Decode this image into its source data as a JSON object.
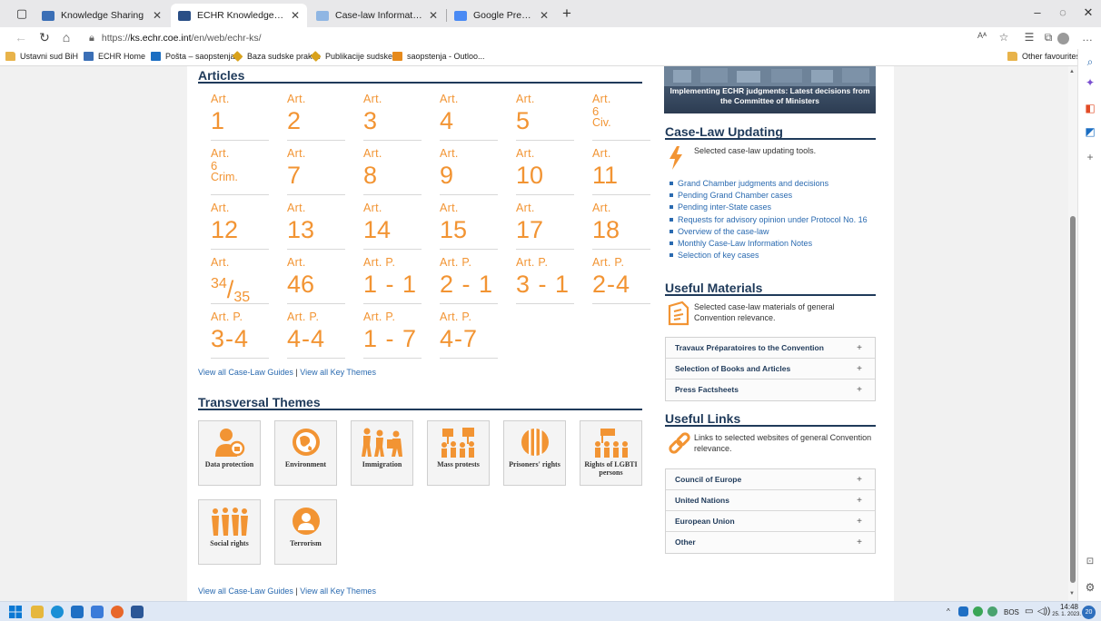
{
  "browser": {
    "tabs": [
      {
        "label": "Knowledge Sharing",
        "active": false
      },
      {
        "label": "ECHR Knowledge Sharing - Gate",
        "active": true
      },
      {
        "label": "Case-law Information Note",
        "active": false
      },
      {
        "label": "Google Prevoditelj",
        "active": false
      }
    ],
    "url_prefix": "https://",
    "url_host": "ks.echr.coe.int",
    "url_path": "/en/web/echr-ks/",
    "reader_label": "Aᴬ",
    "favourites": [
      {
        "label": "Ustavni sud BiH",
        "icon": "folder-icon"
      },
      {
        "label": "ECHR Home",
        "icon": "echr-icon"
      },
      {
        "label": "Pošta – saopstenja...",
        "icon": "outlook-icon"
      },
      {
        "label": "Baza sudske prakse",
        "icon": "diamond-icon"
      },
      {
        "label": "Publikacije sudske...",
        "icon": "diamond-icon"
      },
      {
        "label": "saopstenja - Outloo...",
        "icon": "outlook-icon"
      }
    ],
    "other_favourites": "Other favourites"
  },
  "articles": {
    "heading": "Articles",
    "items": [
      {
        "pre": "Art.",
        "num": "1"
      },
      {
        "pre": "Art.",
        "num": "2"
      },
      {
        "pre": "Art.",
        "num": "3"
      },
      {
        "pre": "Art.",
        "num": "4"
      },
      {
        "pre": "Art.",
        "num": "5"
      },
      {
        "pre": "Art.",
        "num": "6",
        "sub": "Civ."
      },
      {
        "pre": "Art.",
        "num": "6",
        "sub": "Crim."
      },
      {
        "pre": "Art.",
        "num": "7"
      },
      {
        "pre": "Art.",
        "num": "8"
      },
      {
        "pre": "Art.",
        "num": "9"
      },
      {
        "pre": "Art.",
        "num": "10"
      },
      {
        "pre": "Art.",
        "num": "11"
      },
      {
        "pre": "Art.",
        "num": "12"
      },
      {
        "pre": "Art.",
        "num": "13"
      },
      {
        "pre": "Art.",
        "num": "14"
      },
      {
        "pre": "Art.",
        "num": "15"
      },
      {
        "pre": "Art.",
        "num": "17"
      },
      {
        "pre": "Art.",
        "num": "18"
      },
      {
        "pre": "Art.",
        "frac_top": "34",
        "frac_bot": "35"
      },
      {
        "pre": "Art.",
        "num": "46"
      },
      {
        "pre": "Art. P.",
        "num": "1 - 1"
      },
      {
        "pre": "Art. P.",
        "num": "2 - 1"
      },
      {
        "pre": "Art. P.",
        "num": "3 - 1"
      },
      {
        "pre": "Art. P.",
        "num": "2-4"
      },
      {
        "pre": "Art. P.",
        "num": "3-4"
      },
      {
        "pre": "Art. P.",
        "num": "4-4"
      },
      {
        "pre": "Art. P.",
        "num": "1 - 7"
      },
      {
        "pre": "Art. P.",
        "num": "4-7"
      }
    ],
    "link_guides": "View all Case-Law Guides",
    "link_sep": " | ",
    "link_themes": "View all Key Themes"
  },
  "themes": {
    "heading": "Transversal Themes",
    "items": [
      {
        "label": "Data protection",
        "icon": "data-protection-icon"
      },
      {
        "label": "Environment",
        "icon": "environment-icon"
      },
      {
        "label": "Immigration",
        "icon": "immigration-icon"
      },
      {
        "label": "Mass protests",
        "icon": "mass-protests-icon"
      },
      {
        "label": "Prisoners' rights",
        "icon": "prisoners-rights-icon"
      },
      {
        "label": "Rights of LGBTI persons",
        "icon": "lgbti-rights-icon"
      },
      {
        "label": "Social rights",
        "icon": "social-rights-icon"
      },
      {
        "label": "Terrorism",
        "icon": "terrorism-icon"
      }
    ],
    "link_guides": "View all Case-Law Guides",
    "link_sep": " | ",
    "link_themes": "View all Key Themes"
  },
  "sidebar": {
    "banner_text": "Implementing ECHR judgments: Latest decisions from the Committee of Ministers",
    "caselaw": {
      "heading": "Case-Law Updating",
      "desc": "Selected case-law updating tools.",
      "links": [
        "Grand Chamber judgments and decisions",
        "Pending Grand Chamber cases",
        "Pending inter-State cases",
        "Requests for advisory opinion under Protocol No. 16",
        "Overview of the case-law",
        "Monthly Case-Law Information Notes",
        "Selection of key cases"
      ]
    },
    "materials": {
      "heading": "Useful Materials",
      "desc": "Selected case-law materials of general Convention relevance.",
      "items": [
        "Travaux Préparatoires to the Convention",
        "Selection of Books and Articles",
        "Press Factsheets"
      ]
    },
    "links": {
      "heading": "Useful Links",
      "desc": "Links to selected websites of general Convention relevance.",
      "items": [
        "Council of Europe",
        "United Nations",
        "European Union",
        "Other"
      ]
    }
  },
  "taskbar": {
    "language": "BOS",
    "time": "14:48",
    "date": "25. 1. 2023.",
    "notifications": "20"
  },
  "colors": {
    "accent": "#f29433",
    "heading": "#1f3a5a",
    "link": "#2a6ab0"
  }
}
